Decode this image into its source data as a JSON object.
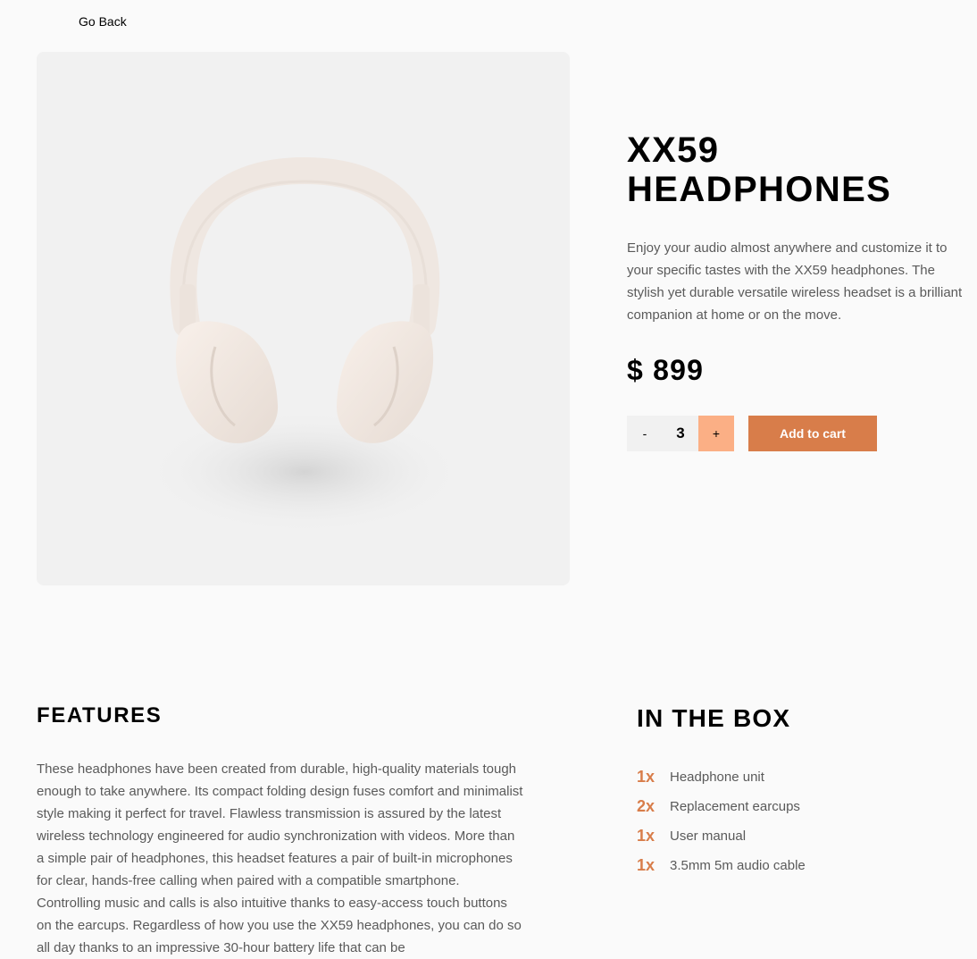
{
  "nav": {
    "go_back": "Go Back"
  },
  "product": {
    "title": "XX59 HEADPHONES",
    "description": "Enjoy your audio almost anywhere and customize it to your specific tastes with the XX59 headphones. The stylish yet durable versatile wireless headset is a brilliant companion at home or on the move.",
    "price": "$ 899",
    "image_icon": "headphones-image"
  },
  "cart": {
    "minus_label": "-",
    "quantity": "3",
    "plus_label": "+",
    "add_label": "Add to cart"
  },
  "features": {
    "title": "FEATURES",
    "text": "These headphones have been created from durable, high-quality materials tough enough to take anywhere. Its compact folding design fuses comfort and minimalist style making it perfect for travel. Flawless transmission is assured by the latest wireless technology engineered for audio synchronization with videos. More than a simple pair of headphones, this headset features a pair of built-in microphones for clear, hands-free calling when paired with a compatible smartphone. Controlling music and calls is also intuitive thanks to easy-access touch buttons on the earcups. Regardless of how you use the XX59 headphones, you can do so all day thanks to an impressive 30-hour battery life that can be"
  },
  "in_the_box": {
    "title": "IN THE BOX",
    "items": [
      {
        "qty": "1x",
        "label": "Headphone unit"
      },
      {
        "qty": "2x",
        "label": "Replacement earcups"
      },
      {
        "qty": "1x",
        "label": "User manual"
      },
      {
        "qty": "1x",
        "label": "3.5mm 5m audio cable"
      }
    ]
  },
  "colors": {
    "accent": "#d87d4a",
    "accent_light": "#fbaf85",
    "background": "#fafafa",
    "panel": "#f1f1f1",
    "body_text": "#5a5a5a"
  }
}
